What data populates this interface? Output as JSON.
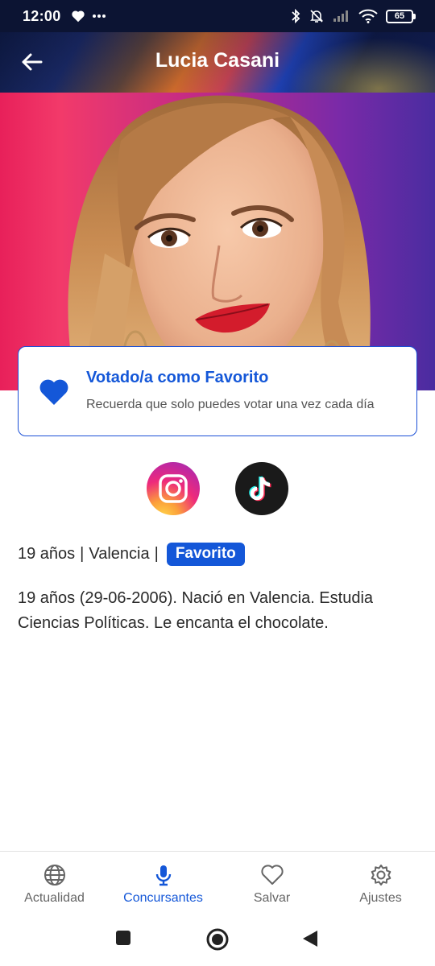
{
  "status_bar": {
    "time": "12:00",
    "battery": "65",
    "icons": [
      "heart-icon",
      "more-icon",
      "bluetooth-icon",
      "mute-icon",
      "signal-icon",
      "wifi-icon",
      "battery-icon"
    ]
  },
  "header": {
    "title": "Lucia Casani",
    "back_icon": "back-arrow-icon"
  },
  "hero": {
    "image": "contestant-portrait"
  },
  "vote_card": {
    "icon": "heart-icon",
    "title": "Votado/a como Favorito",
    "subtitle": "Recuerda que solo puedes votar una vez cada día"
  },
  "socials": [
    {
      "name": "instagram",
      "icon": "instagram-icon"
    },
    {
      "name": "tiktok",
      "icon": "tiktok-icon"
    }
  ],
  "profile": {
    "age": "19 años",
    "separator": "|",
    "city": "Valencia",
    "badge": "Favorito",
    "bio": "19 años (29-06-2006). Nació en Valencia. Estudia Ciencias Políticas. Le encanta el chocolate."
  },
  "bottom_nav": [
    {
      "label": "Actualidad",
      "icon": "globe-icon",
      "active": false
    },
    {
      "label": "Concursantes",
      "icon": "microphone-icon",
      "active": true
    },
    {
      "label": "Salvar",
      "icon": "heart-outline-icon",
      "active": false
    },
    {
      "label": "Ajustes",
      "icon": "gear-icon",
      "active": false
    }
  ],
  "colors": {
    "accent": "#1457d8",
    "status_bar": "#0c1433",
    "text": "#2a2a2a"
  }
}
